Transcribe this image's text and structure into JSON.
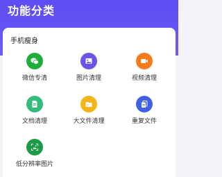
{
  "header": {
    "title": "功能分类"
  },
  "section": {
    "title": "手机瘦身"
  },
  "items": [
    {
      "label": "微信专清",
      "icon": "wechat-icon",
      "color": "#1fae3a"
    },
    {
      "label": "图片清理",
      "icon": "image-icon",
      "color": "#6b54e8"
    },
    {
      "label": "视频清理",
      "icon": "video-icon",
      "color": "#f77a18"
    },
    {
      "label": "文档清理",
      "icon": "document-icon",
      "color": "#33bb7c"
    },
    {
      "label": "大文件清理",
      "icon": "folder-icon",
      "color": "#f2b61b"
    },
    {
      "label": "重复文件",
      "icon": "duplicate-file-icon",
      "color": "#3f5fe8"
    },
    {
      "label": "低分辨率图片",
      "icon": "scan-image-icon",
      "color": "#1d9b46"
    }
  ]
}
